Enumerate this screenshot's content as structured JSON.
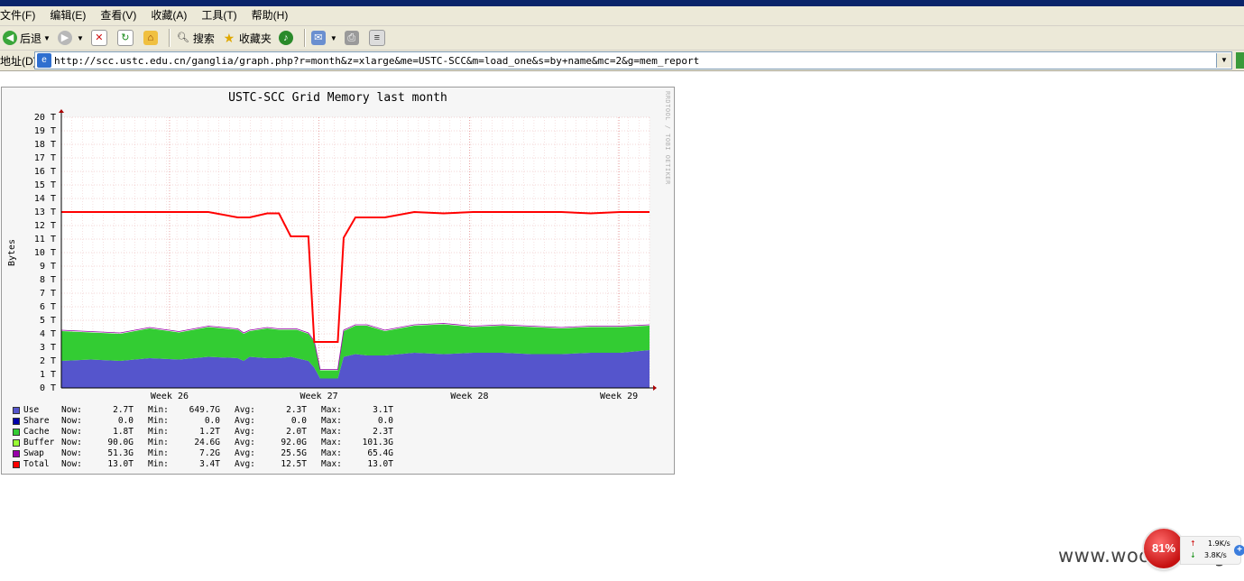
{
  "browser": {
    "menu": [
      "文件(F)",
      "编辑(E)",
      "查看(V)",
      "收藏(A)",
      "工具(T)",
      "帮助(H)"
    ],
    "toolbar": {
      "back_label": "后退",
      "search_label": "搜索",
      "favorites_label": "收藏夹"
    },
    "address": {
      "label": "地址(D)",
      "url": "http://scc.ustc.edu.cn/ganglia/graph.php?r=month&z=xlarge&me=USTC-SCC&m=load_one&s=by+name&mc=2&g=mem_report"
    }
  },
  "graph": {
    "title": "USTC-SCC Grid Memory last month",
    "watermark": "RRDTOOL / TOBI OETIKER",
    "legend": [
      {
        "name": "Use",
        "color": "#5555cc",
        "now": "2.7T",
        "min": "649.7G",
        "avg": "2.3T",
        "max": "3.1T"
      },
      {
        "name": "Share",
        "color": "#0000aa",
        "now": "0.0",
        "min": "0.0",
        "avg": "0.0",
        "max": "0.0"
      },
      {
        "name": "Cache",
        "color": "#33cc33",
        "now": "1.8T",
        "min": "1.2T",
        "avg": "2.0T",
        "max": "2.3T"
      },
      {
        "name": "Buffer",
        "color": "#99ff33",
        "now": "90.0G",
        "min": "24.6G",
        "avg": "92.0G",
        "max": "101.3G"
      },
      {
        "name": "Swap",
        "color": "#9900aa",
        "now": "51.3G",
        "min": "7.2G",
        "avg": "25.5G",
        "max": "65.4G"
      },
      {
        "name": "Total",
        "color": "#ff0000",
        "now": "13.0T",
        "min": "3.4T",
        "avg": "12.5T",
        "max": "13.0T"
      }
    ],
    "legend_labels": {
      "now": "Now:",
      "min": "Min:",
      "avg": "Avg:",
      "max": "Max:"
    }
  },
  "chart_data": {
    "type": "area",
    "title": "USTC-SCC Grid Memory last month",
    "ylabel": "Bytes",
    "xlabel": "",
    "ylim": [
      0,
      20
    ],
    "y_unit": "T",
    "y_ticks": [
      0,
      1,
      2,
      3,
      4,
      5,
      6,
      7,
      8,
      9,
      10,
      11,
      12,
      13,
      14,
      15,
      16,
      17,
      18,
      19,
      20
    ],
    "x_ticks": [
      "Week 26",
      "Week 27",
      "Week 28",
      "Week 29"
    ],
    "x_tick_positions": [
      0.184,
      0.438,
      0.694,
      0.948
    ],
    "grid": true,
    "x": [
      0,
      0.05,
      0.1,
      0.15,
      0.2,
      0.25,
      0.3,
      0.31,
      0.32,
      0.35,
      0.37,
      0.39,
      0.4,
      0.42,
      0.43,
      0.44,
      0.47,
      0.48,
      0.5,
      0.52,
      0.55,
      0.6,
      0.65,
      0.7,
      0.75,
      0.8,
      0.85,
      0.9,
      0.95,
      1.0
    ],
    "series": [
      {
        "name": "Use",
        "color": "#5555cc",
        "values": [
          2.0,
          2.1,
          2.0,
          2.2,
          2.1,
          2.3,
          2.2,
          2.0,
          2.3,
          2.2,
          2.2,
          2.3,
          2.2,
          2.0,
          1.5,
          0.7,
          0.7,
          2.3,
          2.5,
          2.4,
          2.4,
          2.6,
          2.5,
          2.6,
          2.6,
          2.5,
          2.5,
          2.6,
          2.6,
          2.8
        ]
      },
      {
        "name": "Cache",
        "color": "#33cc33",
        "values": [
          2.2,
          2.0,
          2.0,
          2.2,
          2.0,
          2.2,
          2.1,
          2.0,
          1.9,
          2.2,
          2.1,
          2.0,
          2.1,
          2.0,
          1.9,
          0.6,
          0.6,
          1.9,
          2.1,
          2.2,
          1.8,
          2.0,
          2.2,
          1.9,
          2.0,
          2.0,
          1.9,
          1.9,
          1.9,
          1.8
        ]
      },
      {
        "name": "Total",
        "color": "#ff0000",
        "values": [
          13.0,
          13.0,
          13.0,
          13.0,
          13.0,
          13.0,
          12.6,
          12.6,
          12.6,
          12.9,
          12.9,
          11.2,
          11.2,
          11.2,
          3.4,
          3.4,
          3.4,
          11.1,
          12.6,
          12.6,
          12.6,
          13.0,
          12.9,
          13.0,
          13.0,
          13.0,
          13.0,
          12.9,
          13.0,
          13.0
        ]
      }
    ]
  },
  "watermark_site": "www.wooyun.org",
  "netmeter": {
    "percent": "81%",
    "up": "1.9K/s",
    "down": "3.8K/s"
  }
}
